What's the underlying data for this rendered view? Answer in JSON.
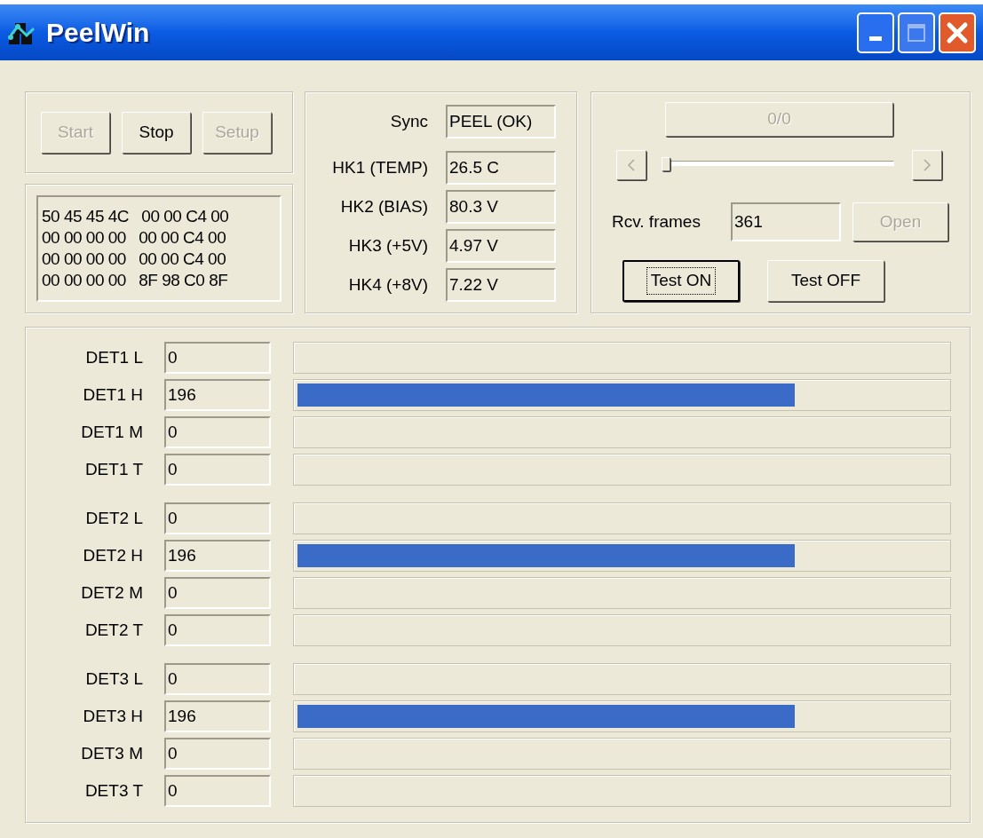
{
  "window": {
    "title": "PeelWin"
  },
  "run_buttons": [
    {
      "label": "Start",
      "disabled": true
    },
    {
      "label": "Stop",
      "disabled": false
    },
    {
      "label": "Setup",
      "disabled": true
    }
  ],
  "hex_dump": [
    "50 45 45 4C   00 00 C4 00",
    "00 00 00 00   00 00 C4 00",
    "00 00 00 00   00 00 C4 00",
    "00 00 00 00   8F 98 C0 8F"
  ],
  "housekeeping": [
    {
      "label": "Sync",
      "value": "PEEL (OK)"
    },
    {
      "label": "HK1 (TEMP)",
      "value": "26.5 C"
    },
    {
      "label": "HK2 (BIAS)",
      "value": "80.3 V"
    },
    {
      "label": "HK3 (+5V)",
      "value": "4.97 V"
    },
    {
      "label": "HK4 (+8V)",
      "value": "7.22 V"
    }
  ],
  "frame_button": {
    "label": "0/0",
    "disabled": true
  },
  "frame_slider": {
    "level": 0
  },
  "rcv_frames": {
    "label": "Rcv. frames",
    "value": "361"
  },
  "open_button": {
    "label": "Open",
    "disabled": true
  },
  "test_buttons": [
    {
      "label": "Test ON",
      "focused": true
    },
    {
      "label": "Test OFF",
      "focused": false
    }
  ],
  "detectors": [
    [
      {
        "label": "DET1 L",
        "value": "0",
        "level": 0
      },
      {
        "label": "DET1 H",
        "value": "196",
        "level": 0.766
      },
      {
        "label": "DET1 M",
        "value": "0",
        "level": 0
      },
      {
        "label": "DET1 T",
        "value": "0",
        "level": 0
      }
    ],
    [
      {
        "label": "DET2 L",
        "value": "0",
        "level": 0
      },
      {
        "label": "DET2 H",
        "value": "196",
        "level": 0.766
      },
      {
        "label": "DET2 M",
        "value": "0",
        "level": 0
      },
      {
        "label": "DET2 T",
        "value": "0",
        "level": 0
      }
    ],
    [
      {
        "label": "DET3 L",
        "value": "0",
        "level": 0
      },
      {
        "label": "DET3 H",
        "value": "196",
        "level": 0.766
      },
      {
        "label": "DET3 M",
        "value": "0",
        "level": 0
      },
      {
        "label": "DET3 T",
        "value": "0",
        "level": 0
      }
    ]
  ]
}
